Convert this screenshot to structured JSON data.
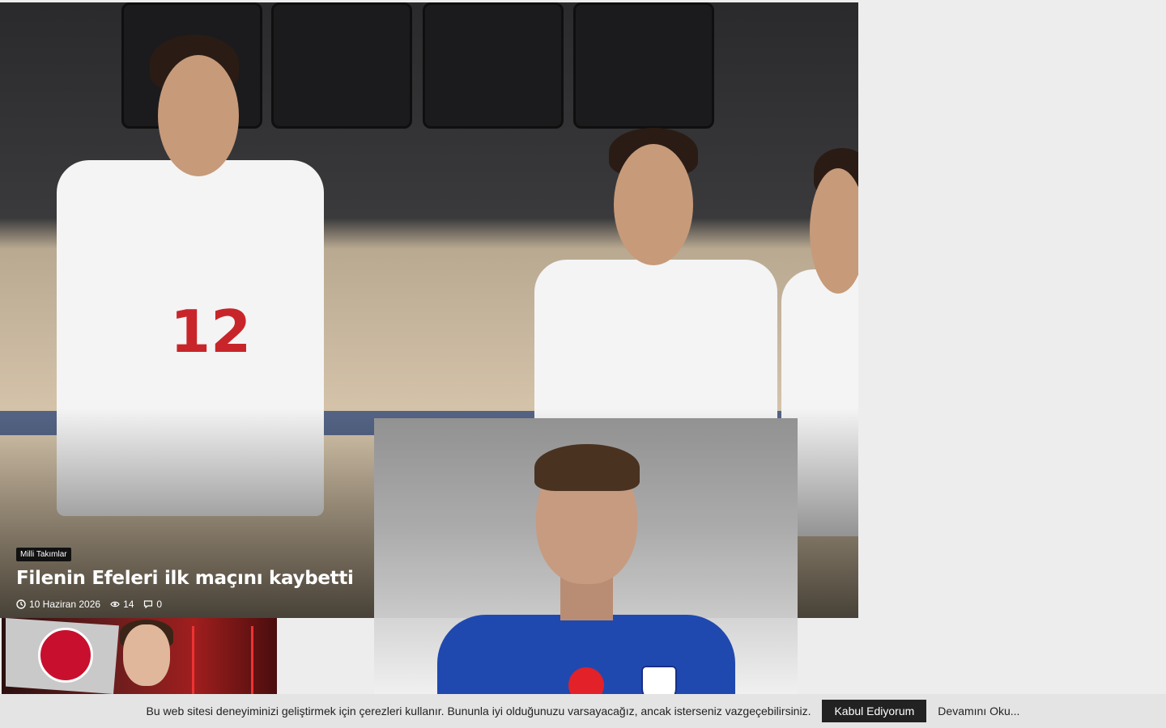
{
  "featured": {
    "category": "Milli Takımlar",
    "title": "Filenin Efeleri ilk maçını kaybetti",
    "date": "10 Haziran 2026",
    "views": "14",
    "comments": "0",
    "jersey_number": "12"
  },
  "cookie_notice": {
    "text": "Bu web sitesi deneyiminizi geliştirmek için çerezleri kullanır. Bununla iyi olduğunuzu varsayacağız, ancak isterseniz vazgeçebilirsiniz.",
    "accept_label": "Kabul Ediyorum",
    "read_more_label": "Devamını Oku..."
  },
  "colors": {
    "badge_bg": "#111111",
    "cookie_bar_bg": "#e4e4e4",
    "accept_button_bg": "#222222"
  },
  "icons": {
    "date": "clock-icon",
    "views": "eye-icon",
    "comments": "comment-icon"
  }
}
